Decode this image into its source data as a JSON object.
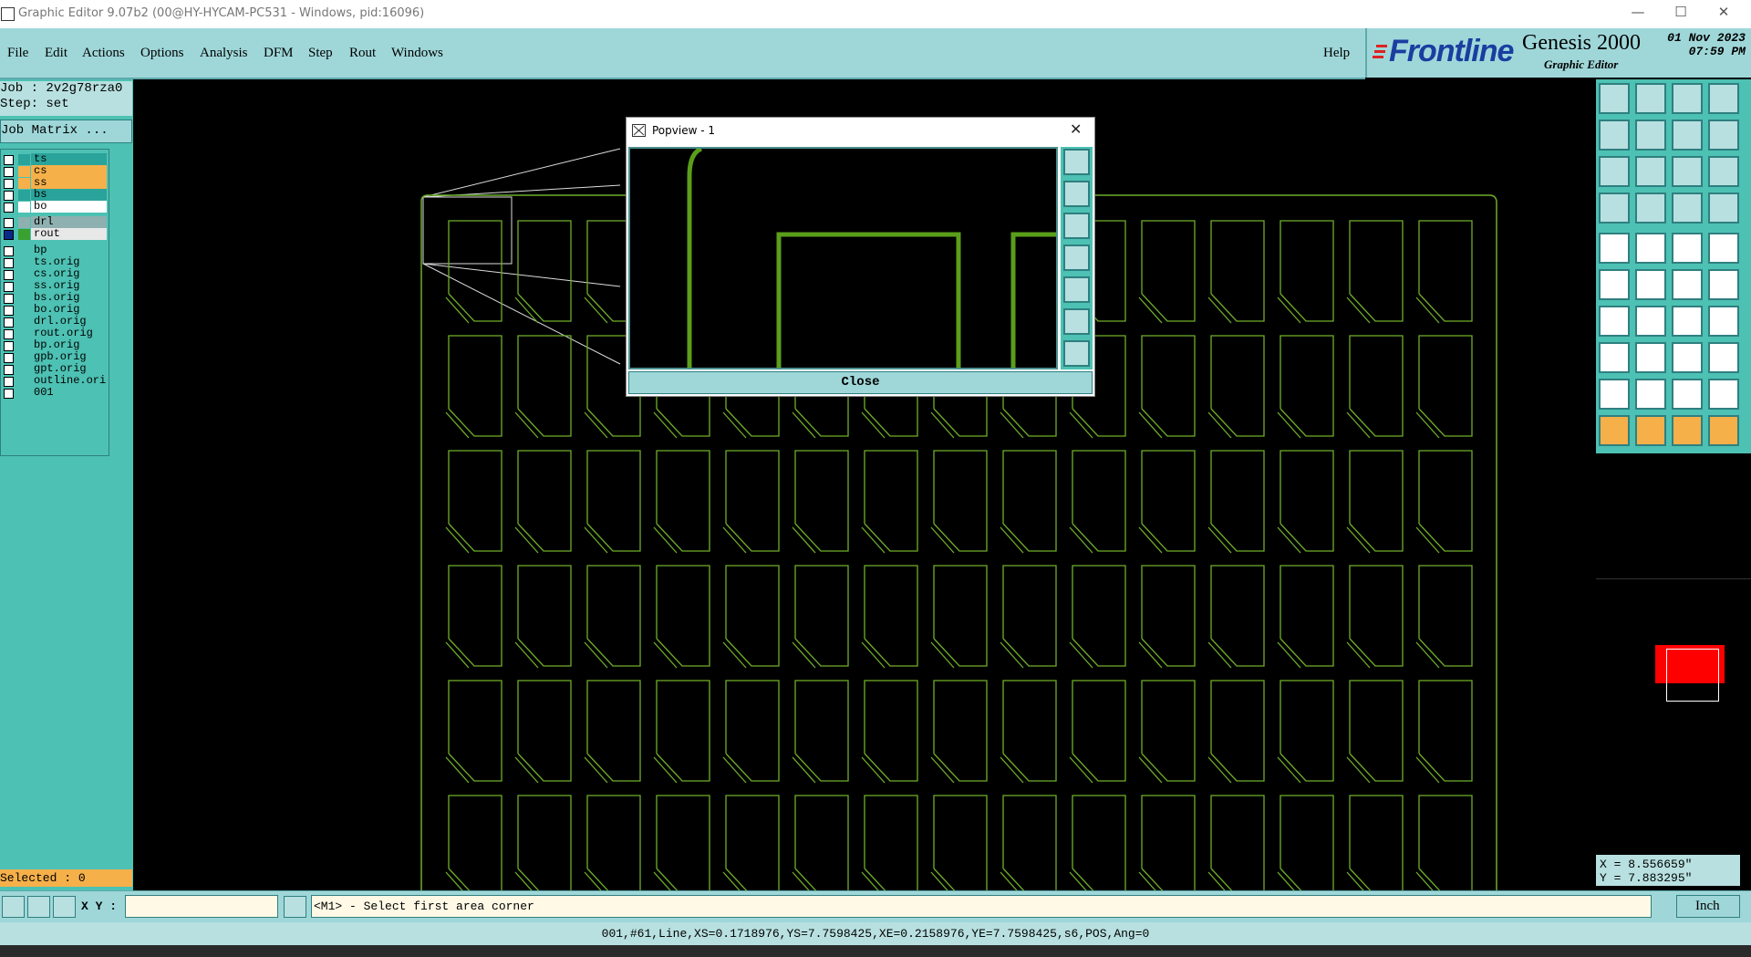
{
  "window": {
    "title": "Graphic Editor 9.07b2 (00@HY-HYCAM-PC531 - Windows, pid:16096)",
    "minimize": "—",
    "maximize": "☐",
    "close": "✕"
  },
  "menu": {
    "items": [
      "File",
      "Edit",
      "Actions",
      "Options",
      "Analysis",
      "DFM",
      "Step",
      "Rout",
      "Windows"
    ],
    "help": "Help"
  },
  "brand": {
    "logo": "Frontline",
    "product": "Genesis 2000",
    "subtitle": "Graphic Editor",
    "date": "01 Nov 2023",
    "time": "07:59 PM"
  },
  "job": {
    "job_line": "Job : 2v2g78rza0",
    "step_line": "Step: set",
    "matrix_button": "Job Matrix ..."
  },
  "layers": [
    {
      "name": "ts",
      "color": "#2aa39a",
      "bg": "#2aa39a"
    },
    {
      "name": "cs",
      "color": "#f5b04a",
      "bg": "#f5b04a"
    },
    {
      "name": "ss",
      "color": "#f5b04a",
      "bg": "#f5b04a"
    },
    {
      "name": "bs",
      "color": "#2aa39a",
      "bg": "#2aa39a"
    },
    {
      "name": "bo",
      "color": "#ffffff",
      "bg": "#ffffff"
    },
    {
      "name": "drl",
      "color": "#8fb0b0",
      "bg": "#8fb0b0"
    },
    {
      "name": "rout",
      "color": "#3aa030",
      "bg": "#e8e8e8",
      "active": true
    },
    {
      "name": "bp",
      "color": "#4dc1b3",
      "bg": "#4dc1b3"
    },
    {
      "name": "ts.orig",
      "color": "#4dc1b3",
      "bg": "#4dc1b3"
    },
    {
      "name": "cs.orig",
      "color": "#4dc1b3",
      "bg": "#4dc1b3"
    },
    {
      "name": "ss.orig",
      "color": "#4dc1b3",
      "bg": "#4dc1b3"
    },
    {
      "name": "bs.orig",
      "color": "#4dc1b3",
      "bg": "#4dc1b3"
    },
    {
      "name": "bo.orig",
      "color": "#4dc1b3",
      "bg": "#4dc1b3"
    },
    {
      "name": "drl.orig",
      "color": "#4dc1b3",
      "bg": "#4dc1b3"
    },
    {
      "name": "rout.orig",
      "color": "#4dc1b3",
      "bg": "#4dc1b3"
    },
    {
      "name": "bp.orig",
      "color": "#4dc1b3",
      "bg": "#4dc1b3"
    },
    {
      "name": "gpb.orig",
      "color": "#4dc1b3",
      "bg": "#4dc1b3"
    },
    {
      "name": "gpt.orig",
      "color": "#4dc1b3",
      "bg": "#4dc1b3"
    },
    {
      "name": "outline.orig",
      "color": "#4dc1b3",
      "bg": "#4dc1b3"
    },
    {
      "name": "001",
      "color": "#4dc1b3",
      "bg": "#4dc1b3"
    }
  ],
  "selected": "Selected : 0",
  "popview": {
    "title": "Popview - 1",
    "close_button": "Close"
  },
  "coords": {
    "x": "X = 8.556659\"",
    "y": "Y = 7.883295\""
  },
  "command": {
    "xy_label": "X Y :",
    "xy_value": "",
    "prompt": "<M1> - Select first area corner",
    "unit": "Inch"
  },
  "status_line": "001,#61,Line,XS=0.1718976,YS=7.7598425,XE=0.2158976,YE=7.7598425,s6,POS,Ang=0",
  "colors": {
    "panel": "#4dc1b3",
    "menubar": "#9fd7d9",
    "rout_line": "#6fae2a",
    "overview_box": "#ff0000"
  }
}
